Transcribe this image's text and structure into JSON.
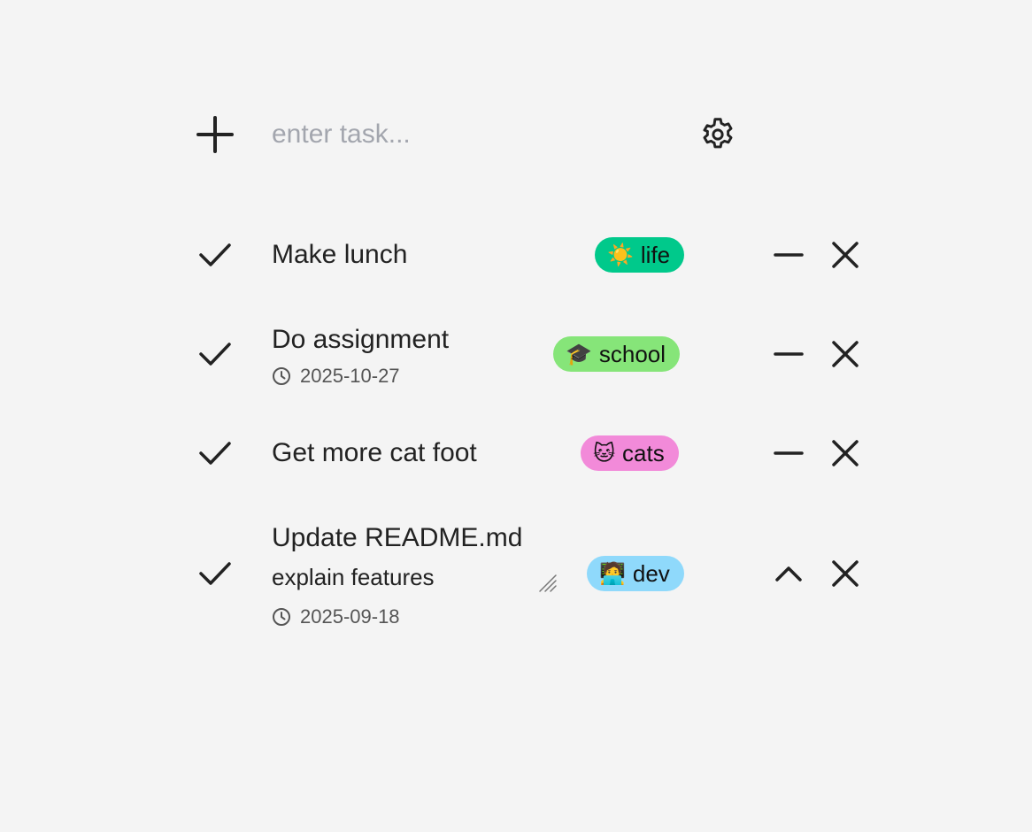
{
  "header": {
    "add_icon": "plus-icon",
    "input_placeholder": "enter task...",
    "input_value": "",
    "settings_icon": "gear-icon"
  },
  "tasks": [
    {
      "title": "Make lunch",
      "note": "",
      "due": "",
      "tag": {
        "emoji": "☀️",
        "label": "life",
        "color": "#00c98b"
      },
      "expanded": false
    },
    {
      "title": "Do assignment",
      "note": "",
      "due": "2025-10-27",
      "tag": {
        "emoji": "🎓",
        "label": "school",
        "color": "#86e579"
      },
      "expanded": false
    },
    {
      "title": "Get more cat foot",
      "note": "",
      "due": "",
      "tag": {
        "emoji": "🐱",
        "label": "cats",
        "color": "#f28ad9"
      },
      "expanded": false
    },
    {
      "title": "Update README.md",
      "note": "explain features",
      "due": "2025-09-18",
      "tag": {
        "emoji": "🧑‍💻",
        "label": "dev",
        "color": "#8fd9fb"
      },
      "expanded": true
    }
  ],
  "colors": {
    "background": "#f4f4f4",
    "text": "#222222",
    "placeholder": "#a3a6ae",
    "muted": "#555555"
  }
}
